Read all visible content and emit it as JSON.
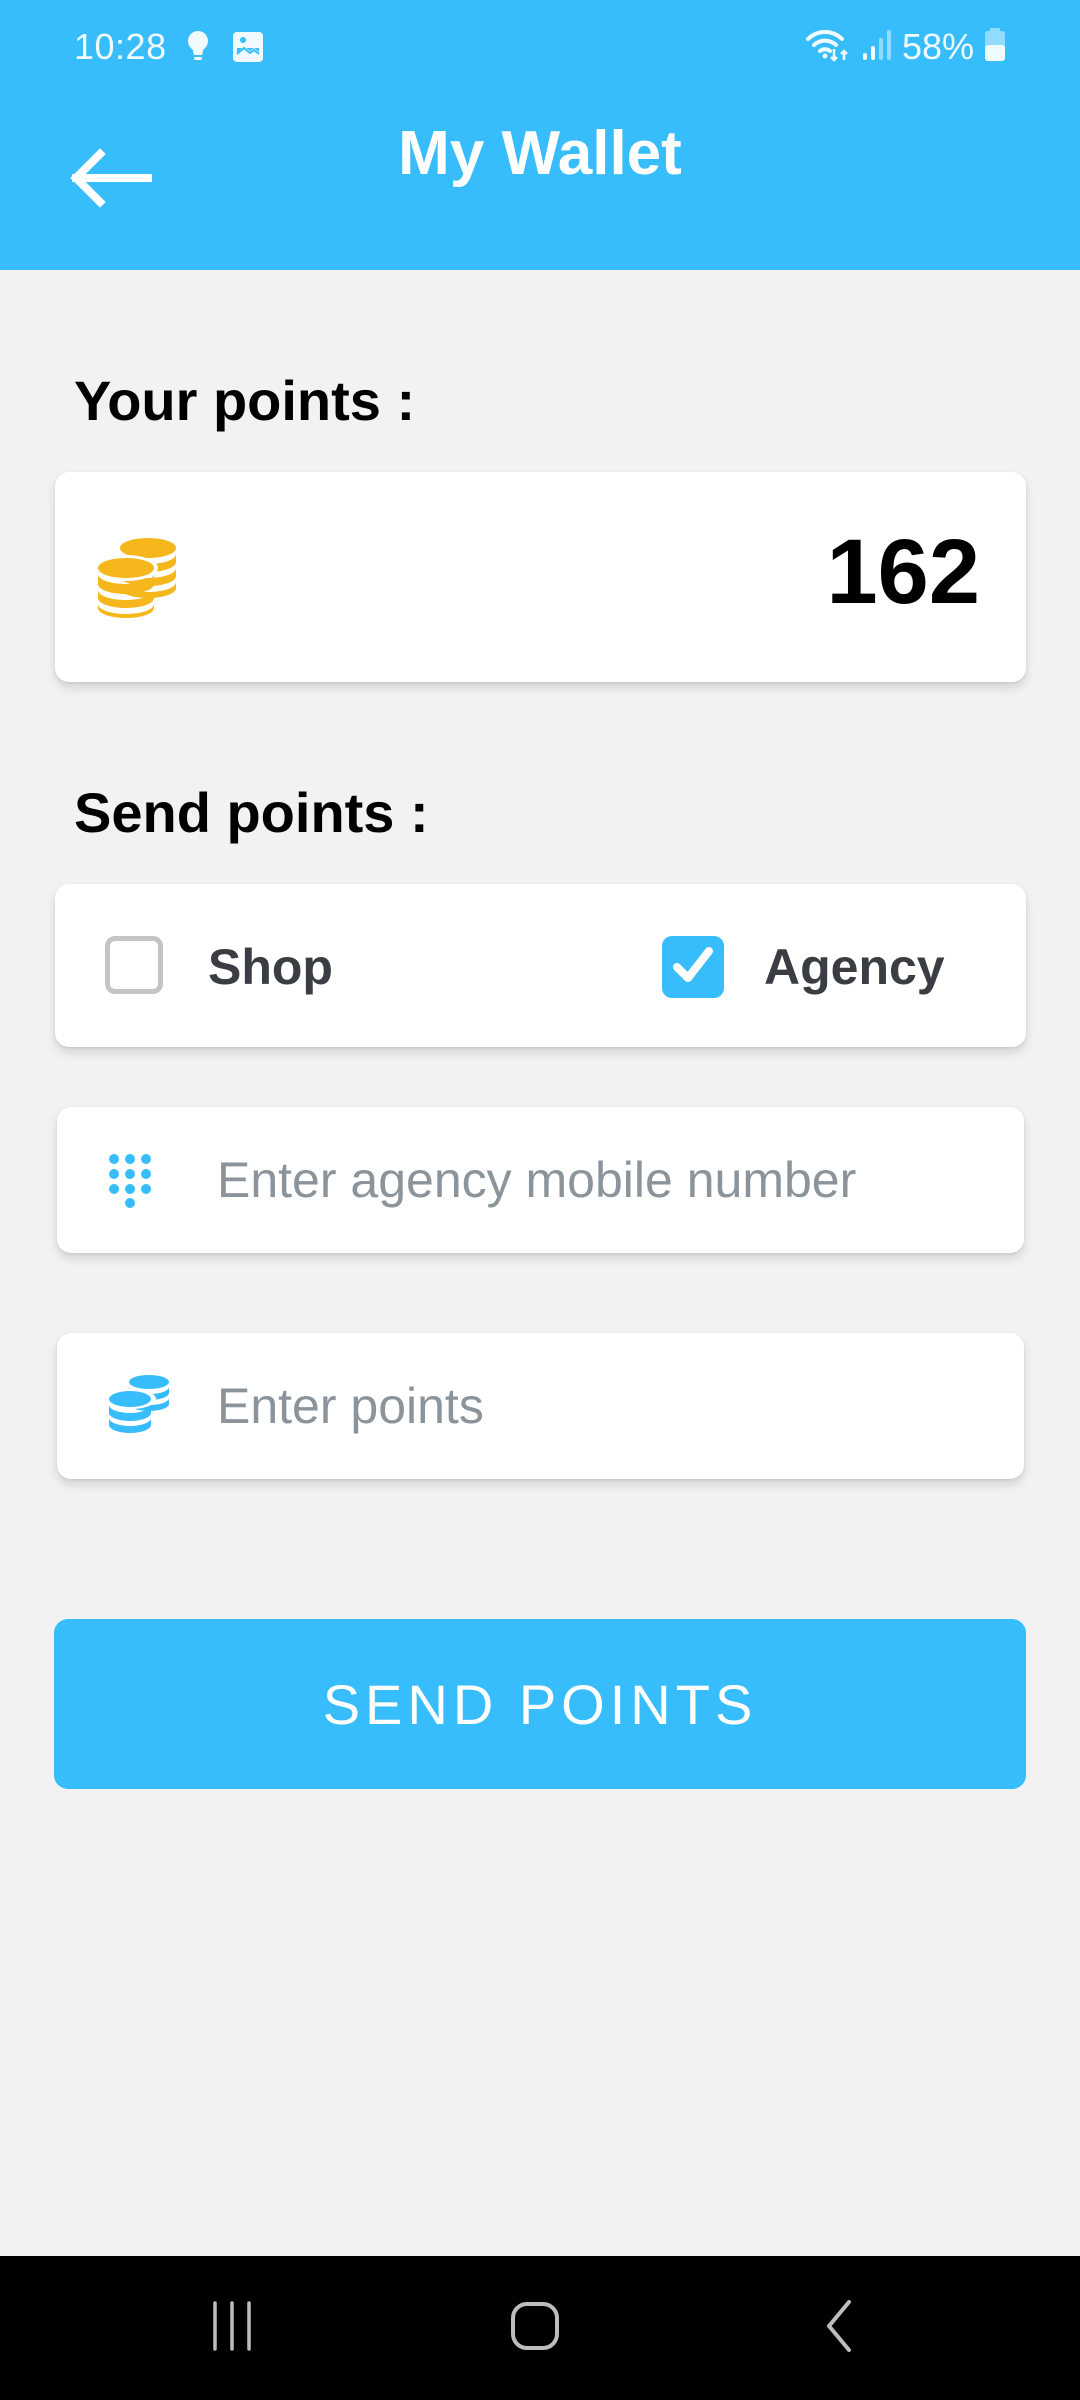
{
  "status_bar": {
    "time": "10:28",
    "left_icons": [
      "lightbulb-icon",
      "image-icon"
    ],
    "right_icons": [
      "wifi-icon",
      "signal-icon",
      "battery-icon"
    ],
    "battery_percent": "58%"
  },
  "header": {
    "title": "My Wallet",
    "back_icon": "arrow-left-icon"
  },
  "balance": {
    "label": "Your points :",
    "icon": "coins-icon",
    "value": "162",
    "icon_color": "#f5b71b"
  },
  "send": {
    "label": "Send points :",
    "recipient_types": [
      {
        "label": "Shop",
        "checked": false
      },
      {
        "label": "Agency",
        "checked": true
      }
    ],
    "mobile_input": {
      "icon": "dialpad-icon",
      "value": "",
      "placeholder": "Enter agency mobile number"
    },
    "points_input": {
      "icon": "coins-icon",
      "value": "",
      "placeholder": "Enter points"
    },
    "submit_label": "SEND POINTS"
  },
  "nav_bar": {
    "buttons": [
      "recent-apps-icon",
      "home-icon",
      "back-icon"
    ]
  },
  "colors": {
    "accent": "#38bdfc",
    "background": "#f2f2f2",
    "gold": "#f5b71b",
    "placeholder": "#8b939b",
    "checkbox_border": "#c4c4c4"
  }
}
